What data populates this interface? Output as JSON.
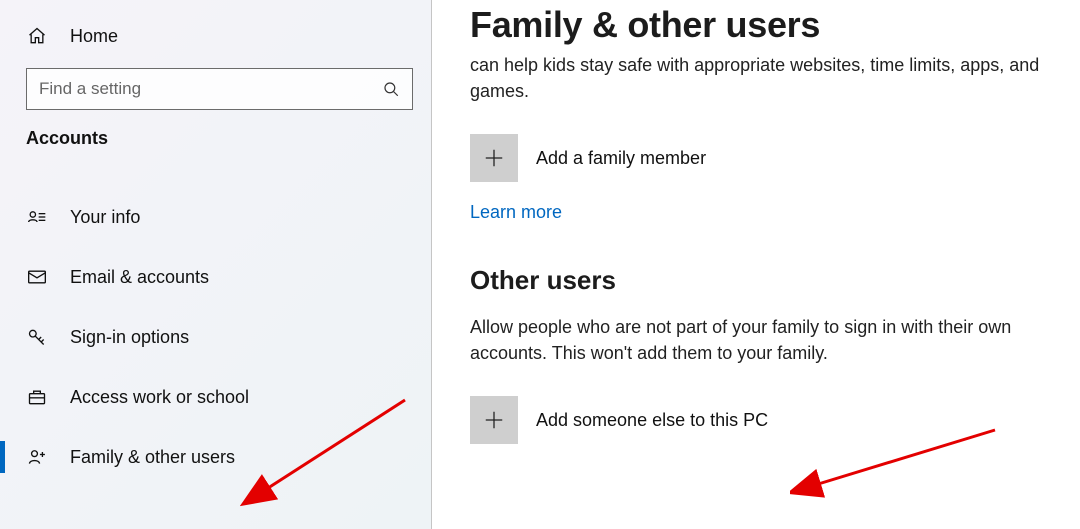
{
  "sidebar": {
    "home_label": "Home",
    "search_placeholder": "Find a setting",
    "section_heading": "Accounts",
    "items": [
      {
        "label": "Your info"
      },
      {
        "label": "Email & accounts"
      },
      {
        "label": "Sign-in options"
      },
      {
        "label": "Access work or school"
      },
      {
        "label": "Family & other users"
      }
    ]
  },
  "main": {
    "page_title": "Family & other users",
    "family_body": "can help kids stay safe with appropriate websites, time limits, apps, and games.",
    "add_family_label": "Add a family member",
    "learn_more": "Learn more",
    "other_users_heading": "Other users",
    "other_users_body": "Allow people who are not part of your family to sign in with their own accounts. This won't add them to your family.",
    "add_other_label": "Add someone else to this PC"
  }
}
